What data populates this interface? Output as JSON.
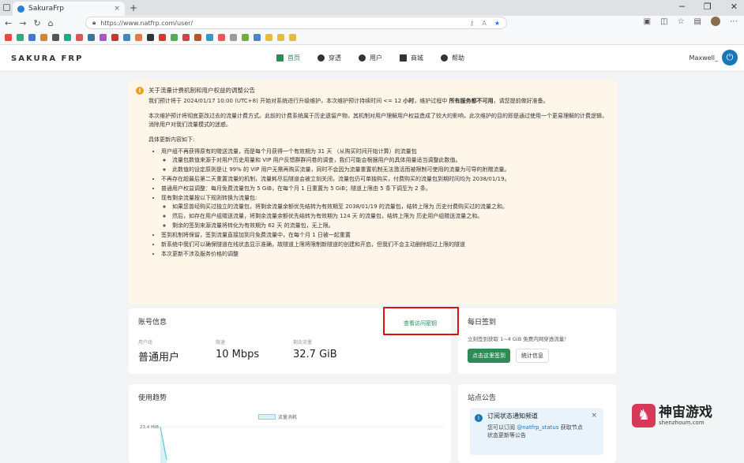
{
  "browser": {
    "tab_title": "SakuraFrp",
    "tab_close": "×",
    "new_tab": "+",
    "url": "https://www.natfrp.com/user/",
    "window_buttons": [
      "─",
      "❐",
      "✕"
    ]
  },
  "site": {
    "logo": "SAKURA FRP",
    "nav": [
      {
        "label": "首页",
        "icon": "home-icon"
      },
      {
        "label": "穿透",
        "icon": "globe-icon"
      },
      {
        "label": "用户",
        "icon": "user-icon"
      },
      {
        "label": "商城",
        "icon": "cart-icon"
      },
      {
        "label": "帮助",
        "icon": "help-icon"
      }
    ],
    "username": "Maxwell_"
  },
  "notice": {
    "title": "关于流量计费机制和用户权益的调整公告",
    "p1_a": "我们预计将于 2024/01/17 10:00 (UTC+8) 开始对系统进行升级维护，本次维护预计持续时间 <= 12 ",
    "p1_b": "小时",
    "p1_c": "，维护过程中 ",
    "p1_d": "所有服务都不可用",
    "p1_e": "，请您提前做好准备。",
    "p2": "本次维护预计将彻底更改过去的流量计费方式。此前的计费系统属于历史遗留产物，其机制对用户理解用户权益造成了较大的影响，此次维护的目的即是通过使用一个更易理解的计费逻辑，消除用户对我们流量模式的迷惑。",
    "p3": "具体更新内容如下:",
    "items": [
      {
        "text": "用户组不再获得原有的赠送流量，而是每个月获得一个有效期为 31 天 （从购买时间开始计算）的流量包",
        "sub": [
          "流量包数值来源于对用户历史用量和 VIP 用户反馈群群问卷的调查，我们可能会根据用户的具体用量适当调整此数值。",
          "此数值的设定原则是让 99% 的 VIP 用户无需再购买流量，同时不会因为流量重置机制无法激活而被限制可使用的流量为可导的附赠流量。"
        ]
      },
      {
        "text": "不再存在超最后第二天重置流量的机制，流量耗尽后隧道会被立刻关闭，流量包仍可单独购买，付费购买的流量包到期时间均为 2038/01/19。",
        "sub": []
      },
      {
        "text": "普通用户权益调整：每月免费流量包为 5 GiB，在每个月 1 日重置为 5 GiB；隧道上限由 5 条下调至为 2 条。",
        "sub": []
      },
      {
        "text": "现有剩余流量按以下规则转换为流量包:",
        "sub": [
          "如果您曾经购买过独立的流量包，将剩余流量余额优先结转为有效期至 2038/01/19 的流量包，结转上限为 历史付费购买过的流量之和。",
          "然后，如存在用户组赠送流量，将剩余流量余额优先结转为有效期为 124 天 的流量包，结转上限为 历史用户组赠送流量之和。",
          "剩余的签到来源流量将转化为有效期为 62 天 的流量包，无上限。"
        ]
      },
      {
        "text": "签到机制将保留，签到流量直接加到月免费流量中，在每个月 1 日被一起重置",
        "sub": []
      },
      {
        "text": "新系统中我们可以确保隧道在线状态显示准确，故隧道上限将限制新隧道的创建和开启，但我们不会主动删除超过上限的隧道",
        "sub": []
      },
      {
        "text": "本次更新不涉及服务价格的调整",
        "sub": []
      }
    ]
  },
  "account": {
    "title": "账号信息",
    "link": "查看访问密钥",
    "stats": [
      {
        "label": "用户组",
        "value": "普通用户"
      },
      {
        "label": "限速",
        "value": "10 Mbps"
      },
      {
        "label": "剩余流量",
        "value": "32.7 GiB"
      }
    ]
  },
  "checkin": {
    "title": "每日签到",
    "desc": "立刻签到获取 1~4 GiB 免费内网穿透流量！",
    "primary_btn": "点击这里签到",
    "secondary_btn": "统计信息"
  },
  "trend": {
    "title": "使用趋势",
    "chart_data": {
      "type": "line",
      "series": [
        {
          "name": "流量消耗",
          "values": [
            23.4,
            2
          ]
        }
      ],
      "ytick_top": "23.4 MiB"
    }
  },
  "announcement": {
    "title": "站点公告",
    "card_title": "订阅状态通知频道",
    "card_text_a": "您可以订阅 ",
    "card_handle": "@natfrp_status",
    "card_text_b": " 获取节点",
    "card_text_c": "状态更新等公告",
    "close": "×"
  },
  "watermark": {
    "name": "神宙游戏",
    "url": "shenzhoum.com"
  },
  "colors": {
    "accent": "#2e8b57",
    "brand_blue": "#1877b8",
    "notice_bg": "#fdf6e9",
    "highlight_box": "#dd1111"
  }
}
